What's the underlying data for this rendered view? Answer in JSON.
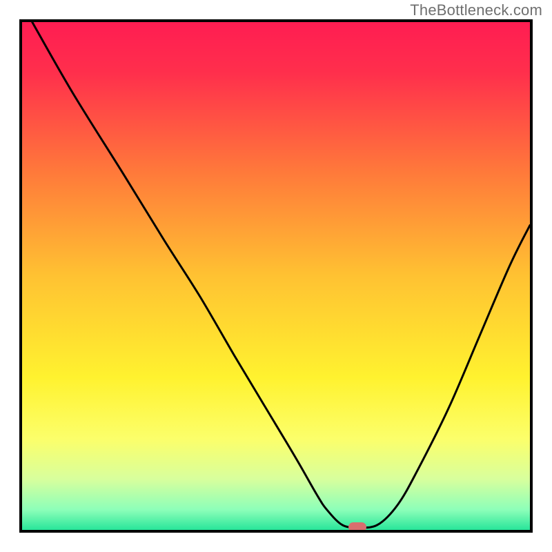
{
  "watermark": "TheBottleneck.com",
  "chart_data": {
    "type": "line",
    "title": "",
    "xlabel": "",
    "ylabel": "",
    "xlim": [
      0,
      100
    ],
    "ylim": [
      0,
      100
    ],
    "grid": false,
    "legend": false,
    "series": [
      {
        "name": "curve",
        "x": [
          2,
          10,
          20,
          28,
          35,
          42,
          48,
          54,
          58,
          60,
          63,
          66,
          70,
          74,
          78,
          84,
          90,
          96,
          100
        ],
        "y": [
          100,
          86,
          70,
          57,
          46,
          34,
          24,
          14,
          7,
          4,
          1,
          0.5,
          1,
          5,
          12,
          24,
          38,
          52,
          60
        ]
      }
    ],
    "marker": {
      "x": 66,
      "y": 0.5,
      "color": "#d86e6e"
    },
    "background_gradient": {
      "stops": [
        {
          "offset": 0.0,
          "color": "#ff1d52"
        },
        {
          "offset": 0.1,
          "color": "#ff2f4c"
        },
        {
          "offset": 0.3,
          "color": "#ff7b3a"
        },
        {
          "offset": 0.5,
          "color": "#ffc232"
        },
        {
          "offset": 0.7,
          "color": "#fff22f"
        },
        {
          "offset": 0.82,
          "color": "#fcff6a"
        },
        {
          "offset": 0.9,
          "color": "#d8ff9d"
        },
        {
          "offset": 0.96,
          "color": "#8dffb9"
        },
        {
          "offset": 1.0,
          "color": "#28e59a"
        }
      ]
    }
  }
}
